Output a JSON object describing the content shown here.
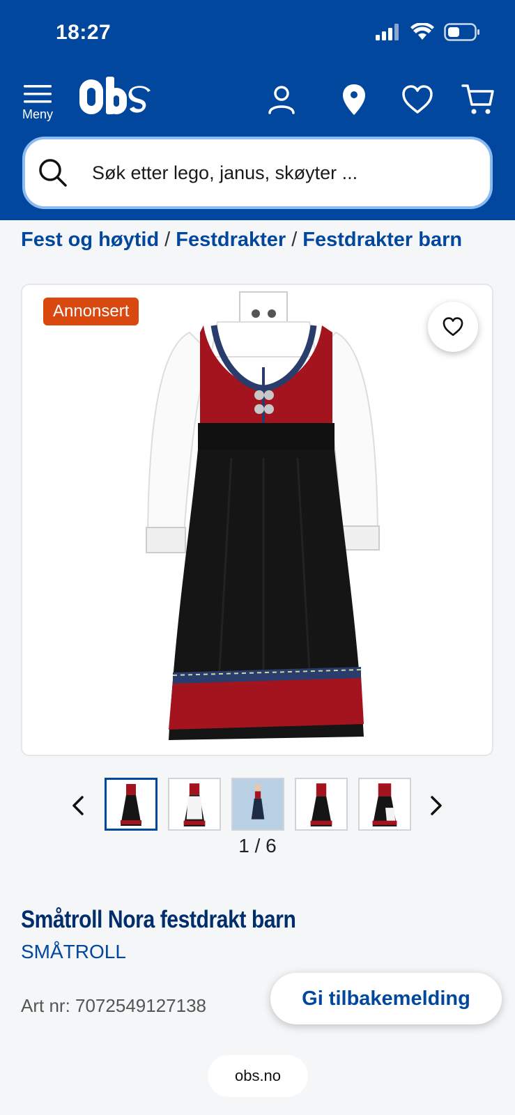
{
  "status_bar": {
    "time": "18:27"
  },
  "header": {
    "menu_label": "Meny",
    "logo_text": "Obs",
    "brand_color": "#00479d",
    "icons": [
      "account-icon",
      "location-pin-icon",
      "heart-icon",
      "cart-icon"
    ]
  },
  "search": {
    "placeholder": "Søk etter lego, janus, skøyter ..."
  },
  "breadcrumb": {
    "items": [
      "Fest og høytid",
      "Festdrakter",
      "Festdrakter barn"
    ],
    "separator": "/"
  },
  "product": {
    "badge": "Annonsert",
    "badge_color": "#d9480f",
    "gallery_counter": "1 / 6",
    "title": "Småtroll Nora festdrakt barn",
    "brand": "SMÅTROLL",
    "art_nr": "Art nr: 7072549127138"
  },
  "feedback_button": "Gi tilbakemelding",
  "browser_url": "obs.no"
}
